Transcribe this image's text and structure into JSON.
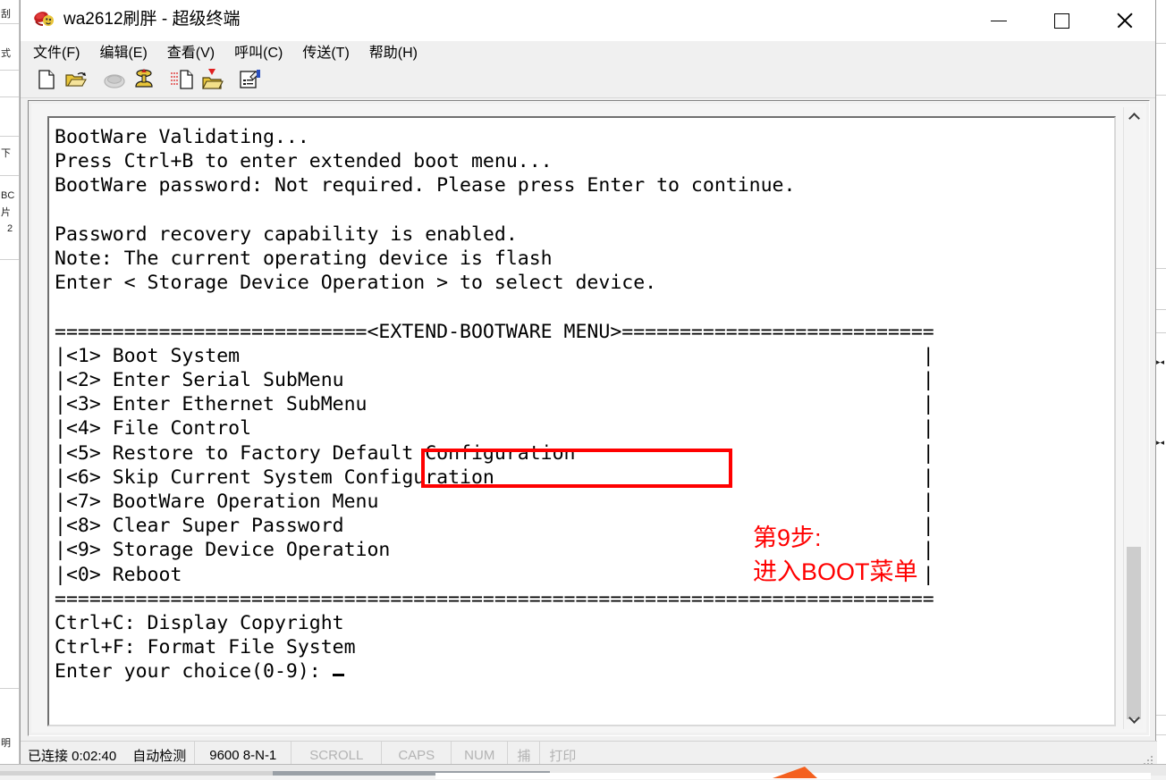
{
  "window": {
    "title": "wa2612刷胖 - 超级终端",
    "app_icon": "hyperterminal-icon",
    "controls": {
      "minimize": "—",
      "maximize": "□",
      "close": "✕"
    }
  },
  "menubar": {
    "items": [
      {
        "label": "文件(F)",
        "name": "menu-file"
      },
      {
        "label": "编辑(E)",
        "name": "menu-edit"
      },
      {
        "label": "查看(V)",
        "name": "menu-view"
      },
      {
        "label": "呼叫(C)",
        "name": "menu-call"
      },
      {
        "label": "传送(T)",
        "name": "menu-transfer"
      },
      {
        "label": "帮助(H)",
        "name": "menu-help"
      }
    ]
  },
  "toolbar": {
    "buttons": [
      {
        "name": "new-connection-icon",
        "title": "新建"
      },
      {
        "name": "open-folder-icon",
        "title": "打开"
      },
      {
        "name": "disconnect-phone-icon",
        "title": "断开"
      },
      {
        "name": "call-phone-icon",
        "title": "呼叫"
      },
      {
        "name": "send-file-icon",
        "title": "发送"
      },
      {
        "name": "receive-file-icon",
        "title": "接收"
      },
      {
        "name": "properties-icon",
        "title": "属性"
      }
    ]
  },
  "terminal": {
    "content": "BootWare Validating...\nPress Ctrl+B to enter extended boot menu...\nBootWare password: Not required. Please press Enter to continue.\n\nPassword recovery capability is enabled.\nNote: The current operating device is flash\nEnter < Storage Device Operation > to select device.\n\n===========================<EXTEND-BOOTWARE MENU>===========================\n|<1> Boot System                                                           |\n|<2> Enter Serial SubMenu                                                  |\n|<3> Enter Ethernet SubMenu                                                |\n|<4> File Control                                                          |\n|<5> Restore to Factory Default Configuration                              |\n|<6> Skip Current System Configuration                                     |\n|<7> BootWare Operation Menu                                               |\n|<8> Clear Super Password                                                  |\n|<9> Storage Device Operation                                              |\n|<0> Reboot                                                                |\n============================================================================\nCtrl+C: Display Copyright\nCtrl+F: Format File System\nEnter your choice(0-9): ",
    "lines": [
      "BootWare Validating...",
      "Press Ctrl+B to enter extended boot menu...",
      "BootWare password: Not required. Please press Enter to continue.",
      "",
      "Password recovery capability is enabled.",
      "Note: The current operating device is flash",
      "Enter < Storage Device Operation > to select device.",
      "",
      "===========================<EXTEND-BOOTWARE MENU>===========================",
      "|<1> Boot System",
      "|<2> Enter Serial SubMenu",
      "|<3> Enter Ethernet SubMenu",
      "|<4> File Control",
      "|<5> Restore to Factory Default Configuration",
      "|<6> Skip Current System Configuration",
      "|<7> BootWare Operation Menu",
      "|<8> Clear Super Password",
      "|<9> Storage Device Operation",
      "|<0> Reboot",
      "============================================================================",
      "Ctrl+C: Display Copyright",
      "Ctrl+F: Format File System",
      "Enter your choice(0-9): "
    ],
    "menu_title": "<EXTEND-BOOTWARE MENU>",
    "menu_options": [
      {
        "key": "<1>",
        "label": "Boot System"
      },
      {
        "key": "<2>",
        "label": "Enter Serial SubMenu"
      },
      {
        "key": "<3>",
        "label": "Enter Ethernet SubMenu"
      },
      {
        "key": "<4>",
        "label": "File Control"
      },
      {
        "key": "<5>",
        "label": "Restore to Factory Default Configuration"
      },
      {
        "key": "<6>",
        "label": "Skip Current System Configuration"
      },
      {
        "key": "<7>",
        "label": "BootWare Operation Menu"
      },
      {
        "key": "<8>",
        "label": "Clear Super Password"
      },
      {
        "key": "<9>",
        "label": "Storage Device Operation"
      },
      {
        "key": "<0>",
        "label": "Reboot"
      }
    ],
    "shortcuts": [
      "Ctrl+C: Display Copyright",
      "Ctrl+F: Format File System"
    ],
    "prompt": "Enter your choice(0-9): ",
    "cursor": "_"
  },
  "annotation": {
    "text": "第9步:\n进入BOOT菜单",
    "color": "#ff0000"
  },
  "highlight": {
    "target": "<EXTEND-BOOTWARE MENU>",
    "color": "#ff0000"
  },
  "statusbar": {
    "connection": "已连接 0:02:40",
    "detect": "自动检测",
    "settings": "9600 8-N-1",
    "scroll": "SCROLL",
    "caps": "CAPS",
    "num": "NUM",
    "capture": "捕",
    "print": "打印"
  },
  "scrollbar": {
    "up_arrow": "▲",
    "down_arrow": "▼"
  },
  "background": {
    "left_fragments": [
      "刮",
      "式",
      "下",
      "BC",
      "片",
      "2",
      "明"
    ],
    "right_marks": [
      "▸◂",
      "▸◂"
    ]
  }
}
